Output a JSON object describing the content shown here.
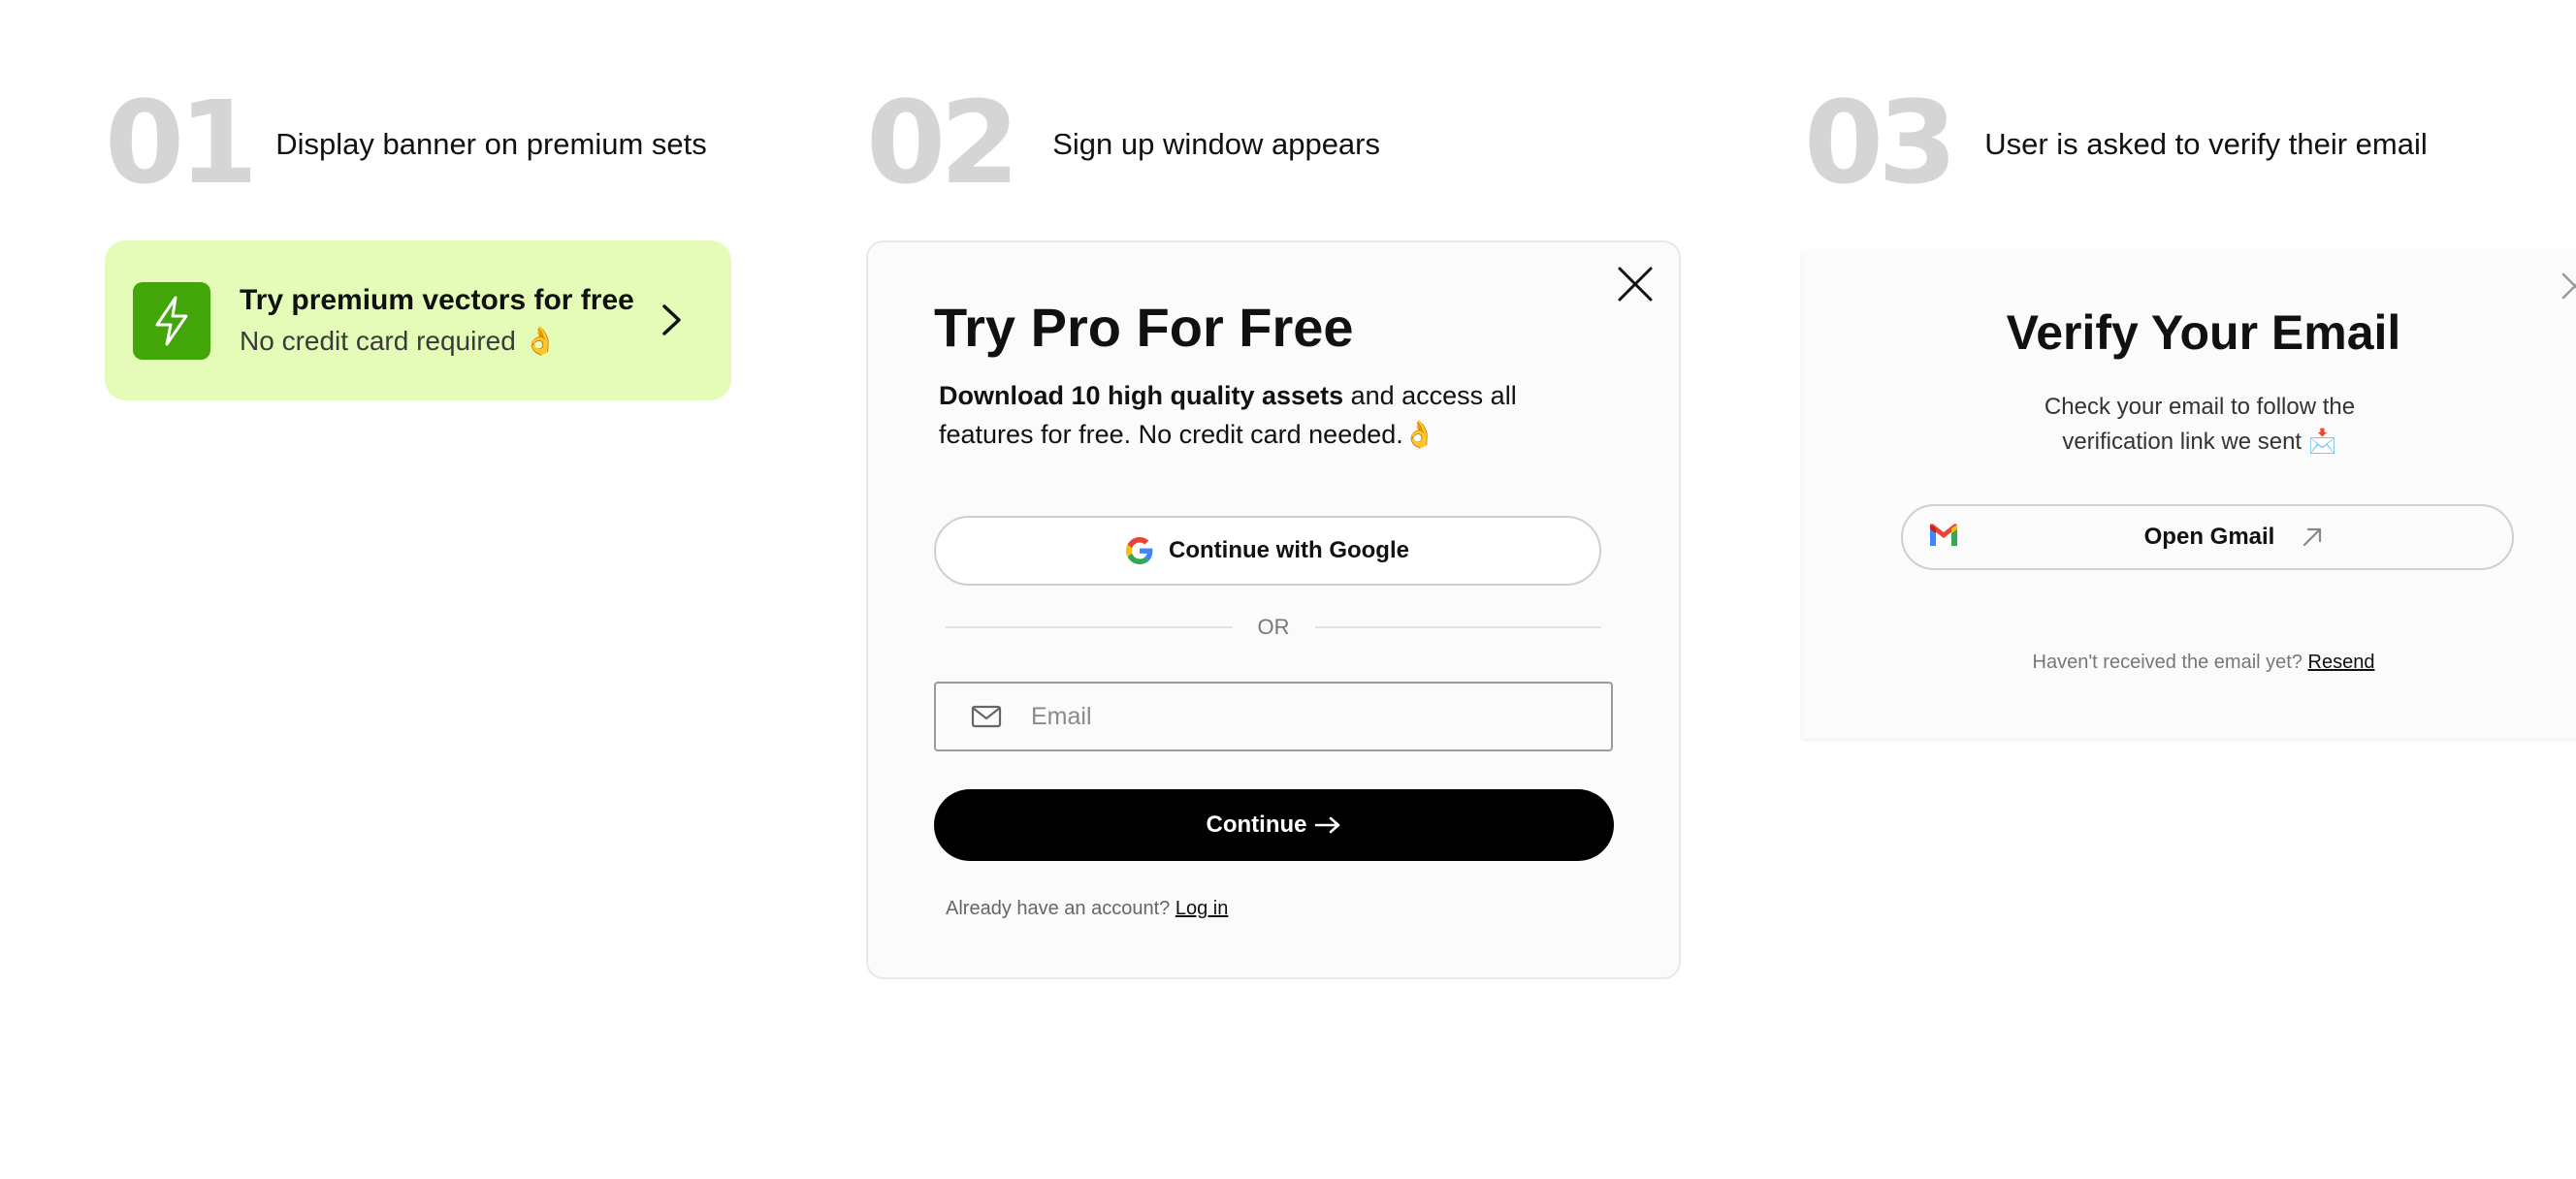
{
  "steps": [
    {
      "number": "01",
      "title": "Display banner on premium sets"
    },
    {
      "number": "02",
      "title": "Sign up window appears"
    },
    {
      "number": "03",
      "title": "User is asked to verify their email"
    }
  ],
  "banner": {
    "title": "Try premium vectors for free",
    "subtitle": "No credit card required 👌",
    "icon": "lightning-icon",
    "chevron_icon": "chevron-right-icon",
    "background": "#e5fcb8",
    "icon_bg": "#42a608"
  },
  "signup": {
    "title": "Try Pro For Free",
    "desc_bold": "Download 10 high quality assets",
    "desc_rest": " and access all features for free. No credit card needed.👌",
    "google_label": "Continue with Google",
    "or_label": "OR",
    "email_placeholder": "Email",
    "continue_label": "Continue",
    "already_text": "Already have an account? ",
    "login_label": "Log in"
  },
  "verify": {
    "title": "Verify Your Email",
    "desc": "Check your email to follow the verification link we sent 📩",
    "gmail_label": "Open Gmail",
    "resend_text": "Haven't received the email yet? ",
    "resend_label": "Resend"
  }
}
